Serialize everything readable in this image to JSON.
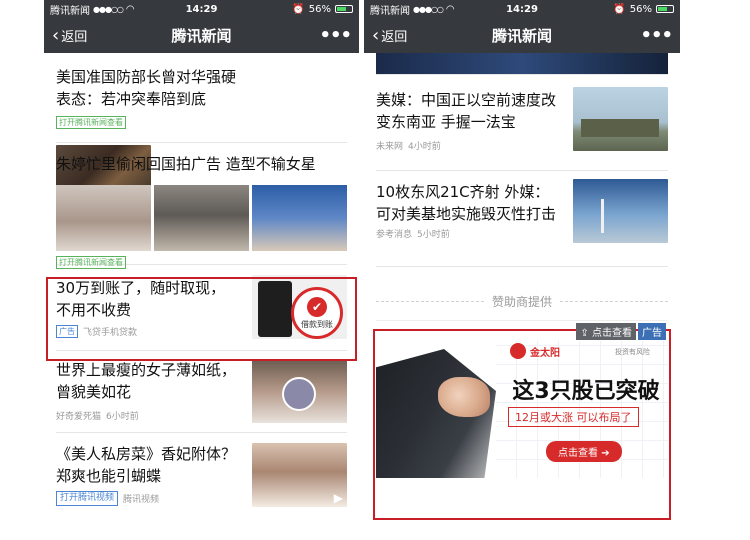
{
  "colors": {
    "header_bg": "#363a3e",
    "highlight_red": "#c81f26",
    "tag_green": "#59b35d",
    "tag_blue": "#4a86d4",
    "accent_red": "#d72b2b"
  },
  "status_bar": {
    "carrier": "腾讯新闻",
    "signal": "●●●○○",
    "time": "14:29",
    "battery": "56%"
  },
  "nav": {
    "back_label": "返回",
    "title": "腾讯新闻",
    "more": "•••"
  },
  "left_feed": {
    "items": [
      {
        "title": "美国准国防部长曾对华强硬表态：若冲突奉陪到底",
        "tag": "打开腾讯新闻查看"
      },
      {
        "title": "朱婷忙里偷闲回国拍广告 造型不输女星",
        "tag": "打开腾讯新闻查看"
      },
      {
        "title": "30万到账了，随时取现，不用不收费",
        "tag": "广告",
        "source": "飞贷手机贷款",
        "badge_label": "借款到账"
      },
      {
        "title": "世界上最瘦的女子薄如纸，曾貌美如花",
        "source": "好奇爱死猫",
        "time": "6小时前"
      },
      {
        "title": "《美人私房菜》香妃附体？郑爽也能引蝴蝶",
        "tag": "打开腾讯视频",
        "source": "腾讯视频"
      }
    ]
  },
  "right_feed": {
    "items": [
      {
        "title": "美媒：中国正以空前速度改变东南亚 手握一法宝",
        "source": "未来网",
        "time": "4小时前"
      },
      {
        "title": "10枚东风21C齐射 外媒：可对美基地实施毁灭性打击",
        "source": "参考消息",
        "time": "5小时前"
      }
    ],
    "sponsor_label": "赞助商提供",
    "ad": {
      "view_label": "点击查看",
      "ad_label": "广告",
      "brand": "金太阳",
      "risk_note": "投资有风险",
      "headline": "这3只股已突破",
      "subline": "12月或大涨 可以布局了",
      "cta": "点击查看"
    }
  }
}
